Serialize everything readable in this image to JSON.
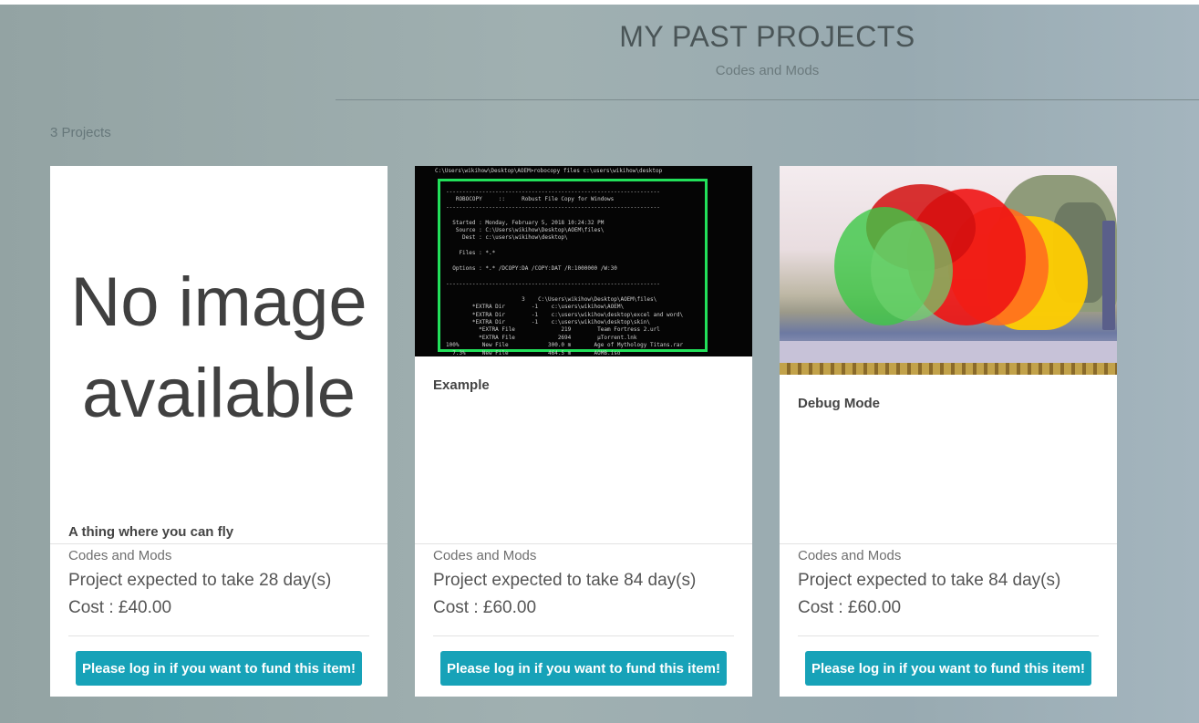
{
  "header": {
    "title": "MY PAST PROJECTS",
    "subtitle": "Codes and Mods"
  },
  "project_count": "3 Projects",
  "projects": [
    {
      "image_text": "No image available",
      "title": "A thing where you can fly",
      "category": "Codes and Mods",
      "duration": "Project expected to take 28 day(s)",
      "cost": "Cost : £40.00",
      "button_label": "Please log in if you want to fund this item!"
    },
    {
      "title": "Example",
      "category": "Codes and Mods",
      "duration": "Project expected to take 84 day(s)",
      "cost": "Cost : £60.00",
      "button_label": "Please log in if you want to fund this item!",
      "terminal": {
        "prompt": "C:\\Users\\wikihow\\Desktop\\AOEM>robocopy files c:\\users\\wikihow\\desktop",
        "lines": [
          "-----------------------------------------------------------------",
          "   ROBOCOPY     ::     Robust File Copy for Windows",
          "-----------------------------------------------------------------",
          "",
          "  Started : Monday, February 5, 2018 10:24:32 PM",
          "   Source : C:\\Users\\wikihow\\Desktop\\AOEM\\files\\",
          "     Dest : c:\\users\\wikihow\\desktop\\",
          "",
          "    Files : *.*",
          "",
          "  Options : *.* /DCOPY:DA /COPY:DAT /R:1000000 /W:30",
          "",
          "-----------------------------------------------------------------",
          "",
          "                       3    C:\\Users\\wikihow\\Desktop\\AOEM\\files\\",
          "        *EXTRA Dir        -1    c:\\users\\wikihow\\AOEM\\",
          "        *EXTRA Dir        -1    c:\\users\\wikihow\\desktop\\excel and word\\",
          "        *EXTRA Dir        -1    c:\\users\\wikihow\\desktop\\skin\\",
          "          *EXTRA File              219        Team Fortress 2.url",
          "          *EXTRA File             2694        µTorrent.lnk",
          "100%       New File            300.0 m       Age of Mythology Titans.rar",
          "  7.3%     New File            464.5 m       AOMB.iso"
        ]
      }
    },
    {
      "title": "Debug Mode",
      "category": "Codes and Mods",
      "duration": "Project expected to take 84 day(s)",
      "cost": "Cost : £60.00",
      "button_label": "Please log in if you want to fund this item!"
    }
  ],
  "colors": {
    "button": "#17a2b8",
    "terminal_border": "#22e05a"
  }
}
